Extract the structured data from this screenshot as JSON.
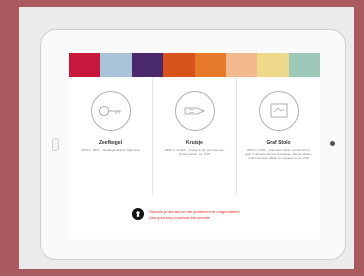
{
  "colors": {
    "background": "#a85a5f",
    "stripes": [
      "#c8173c",
      "#a9c4d8",
      "#4a2a6a",
      "#d6541c",
      "#e67a2a",
      "#f2b98c",
      "#eed98a",
      "#9ec8b8"
    ],
    "accent_red": "#e0281e"
  },
  "panels": [
    {
      "title": "Zeefkegel",
      "description": "KPM nr. 0641 – Zeefkegel Enoris, Rijnmond",
      "icon": "key-icon"
    },
    {
      "title": "Kruisje",
      "description": "KPM nr. 10.003 – Kruisje in de vorm van een kruisje tussen, ca. 1720",
      "icon": "keyhole-icon"
    },
    {
      "title": "Graf Stolo",
      "description": "KPM nr. 0196 – Graf steen Stolo, vondst uit het graf, in de kerk van het Kruiswege, aan de wieken onder het land maken en opnieuw in ca. 1720",
      "icon": "grave-icon"
    }
  ],
  "footer": {
    "line1": "Gebruik je sleutel om de geheimen te ontgrendelen",
    "line2": "Use your key to unlock the secrets"
  }
}
